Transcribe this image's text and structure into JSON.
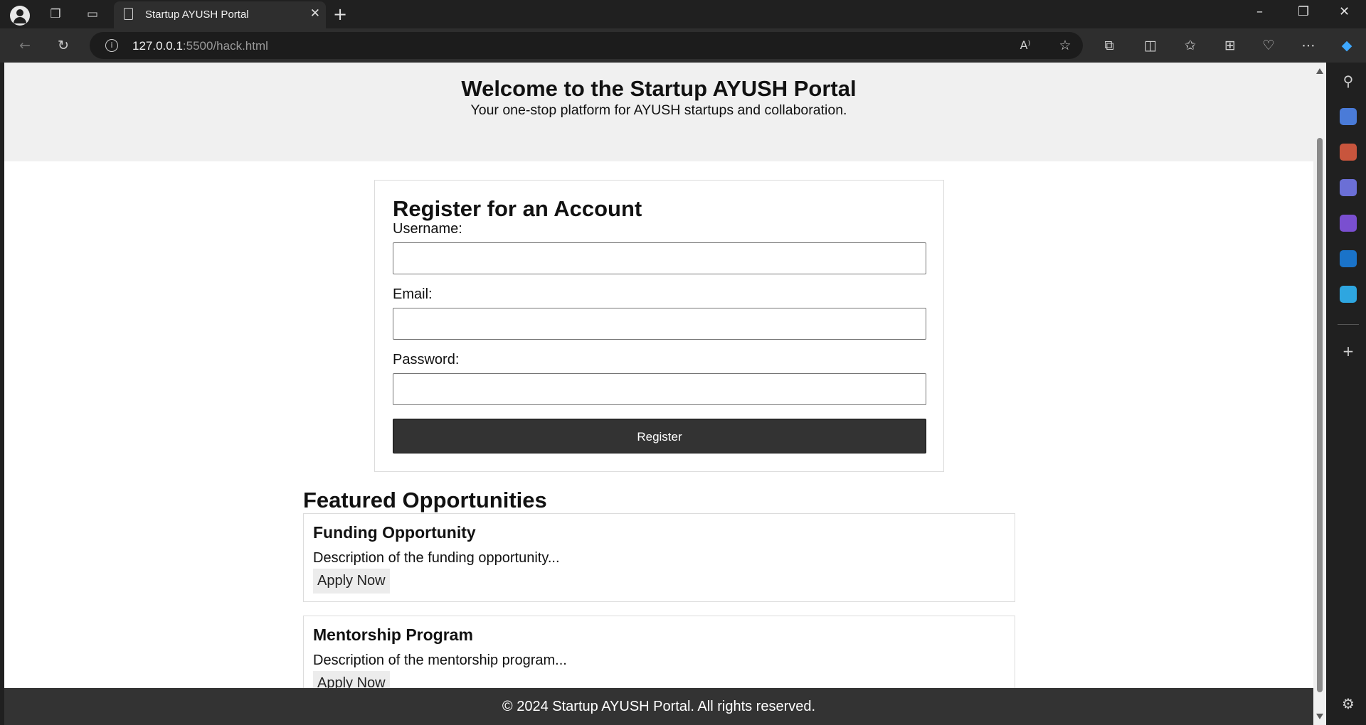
{
  "browser": {
    "tab_title": "Startup AYUSH Portal",
    "url_host": "127.0.0.1",
    "url_rest": ":5500/hack.html",
    "icons": {
      "profile": "profile-icon",
      "workspaces": "workspaces-icon",
      "tab_actions": "tab-actions-icon",
      "page": "page-icon",
      "close_tab": "close-icon",
      "new_tab": "plus-icon",
      "back": "back-arrow-icon",
      "refresh": "refresh-icon",
      "site_info": "info-icon",
      "read_aloud": "read-aloud-icon",
      "favorite": "star-icon",
      "extensions": "puzzle-icon",
      "split_screen": "split-screen-icon",
      "favorites": "favorites-icon",
      "collections": "collections-icon",
      "health": "heartbeat-icon",
      "more": "more-icon",
      "copilot": "copilot-icon"
    },
    "sidebar_icons": [
      "search-icon",
      "tag-icon",
      "toolbox-icon",
      "chess-icon",
      "copilot-sidebar-icon",
      "outlook-icon",
      "send-icon",
      "add-icon",
      "settings-icon"
    ]
  },
  "header": {
    "title": "Welcome to the Startup AYUSH Portal",
    "subtitle": "Your one-stop platform for AYUSH startups and collaboration."
  },
  "register": {
    "heading": "Register for an Account",
    "username_label": "Username:",
    "email_label": "Email:",
    "password_label": "Password:",
    "submit_label": "Register"
  },
  "featured": {
    "heading": "Featured Opportunities",
    "cards": [
      {
        "title": "Funding Opportunity",
        "description": "Description of the funding opportunity...",
        "action": "Apply Now"
      },
      {
        "title": "Mentorship Program",
        "description": "Description of the mentorship program...",
        "action": "Apply Now"
      }
    ]
  },
  "footer": {
    "text": "© 2024 Startup AYUSH Portal. All rights reserved."
  },
  "colors": {
    "header_bg": "#f0f0f0",
    "button_bg": "#333333",
    "footer_bg": "#333333",
    "chrome_bg": "#202020"
  }
}
